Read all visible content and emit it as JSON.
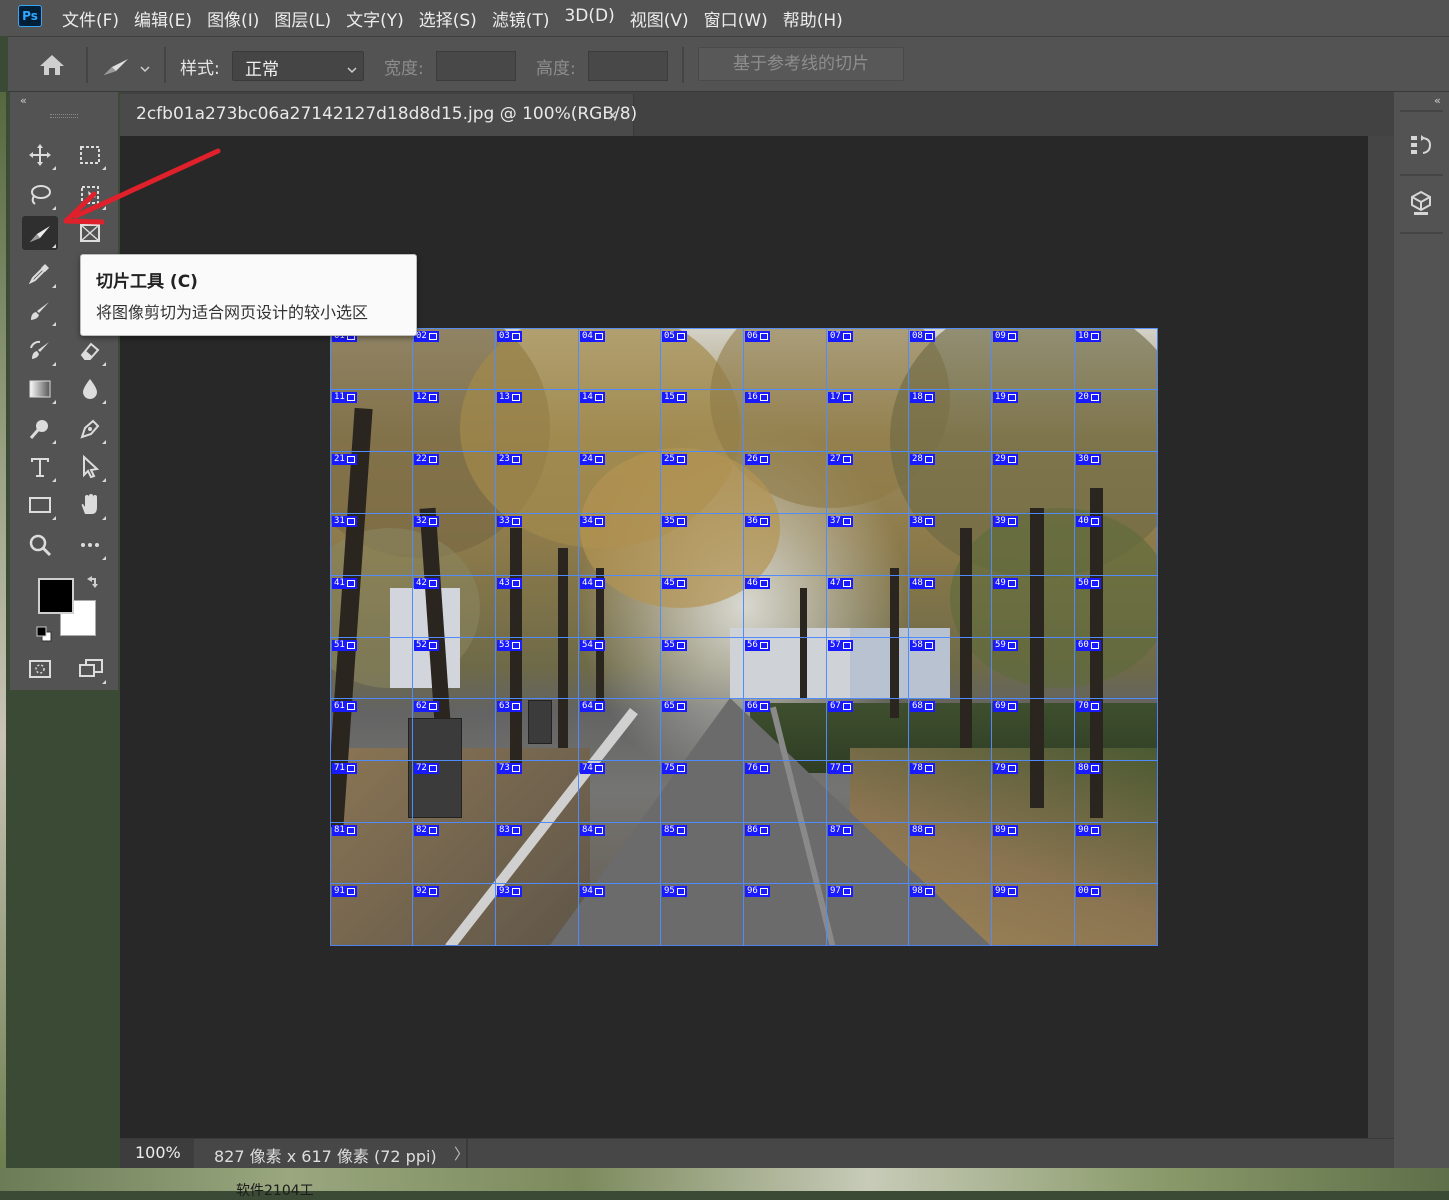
{
  "app": {
    "logo": "Ps"
  },
  "menu": [
    "文件(F)",
    "编辑(E)",
    "图像(I)",
    "图层(L)",
    "文字(Y)",
    "选择(S)",
    "滤镜(T)",
    "3D(D)",
    "视图(V)",
    "窗口(W)",
    "帮助(H)"
  ],
  "options_bar": {
    "style_label": "样式:",
    "style_value": "正常",
    "width_label": "宽度:",
    "width_value": "",
    "height_label": "高度:",
    "height_value": "",
    "guides_button": "基于参考线的切片"
  },
  "document": {
    "tab_title": "2cfb01a273bc06a27142127d18d8d15.jpg @ 100%(RGB/8)",
    "close_glyph": "×"
  },
  "status": {
    "zoom": "100%",
    "info": "827 像素 x 617 像素 (72 ppi)",
    "arrow": "〉"
  },
  "tooltip": {
    "title": "切片工具 (C)",
    "description": "将图像剪切为适合网页设计的较小选区"
  },
  "slices": {
    "rows": 10,
    "cols": 10,
    "labels": [
      "01",
      "02",
      "03",
      "04",
      "05",
      "06",
      "07",
      "08",
      "09",
      "10",
      "11",
      "12",
      "13",
      "14",
      "15",
      "16",
      "17",
      "18",
      "19",
      "20",
      "21",
      "22",
      "23",
      "24",
      "25",
      "26",
      "27",
      "28",
      "29",
      "30",
      "31",
      "32",
      "33",
      "34",
      "35",
      "36",
      "37",
      "38",
      "39",
      "40",
      "41",
      "42",
      "43",
      "44",
      "45",
      "46",
      "47",
      "48",
      "49",
      "50",
      "51",
      "52",
      "53",
      "54",
      "55",
      "56",
      "57",
      "58",
      "59",
      "60",
      "61",
      "62",
      "63",
      "64",
      "65",
      "66",
      "67",
      "68",
      "69",
      "70",
      "71",
      "72",
      "73",
      "74",
      "75",
      "76",
      "77",
      "78",
      "79",
      "80",
      "81",
      "82",
      "83",
      "84",
      "85",
      "86",
      "87",
      "88",
      "89",
      "90",
      "91",
      "92",
      "93",
      "94",
      "95",
      "96",
      "97",
      "98",
      "99",
      "00"
    ]
  },
  "desktop": {
    "taskbar_text": "软件2104工"
  },
  "colors": {
    "slice_line": "#508cff",
    "slice_badge": "#1a1aff",
    "annotation_arrow": "#e0202a",
    "foreground": "#000000",
    "background": "#ffffff"
  },
  "toolbar_collapse": "‹‹",
  "panel_collapse": "‹‹"
}
